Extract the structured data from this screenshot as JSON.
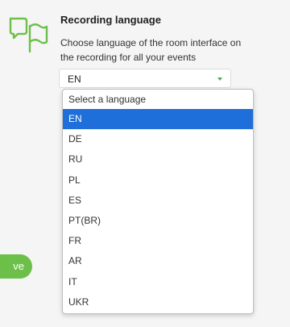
{
  "section": {
    "title": "Recording language",
    "description": "Choose language of the room interface on the recording for all your events",
    "icon": "chat-flag-icon",
    "accent_color": "#6cc04a"
  },
  "select": {
    "value": "EN",
    "placeholder": "Select a language",
    "options": [
      "EN",
      "DE",
      "RU",
      "PL",
      "ES",
      "PT(BR)",
      "FR",
      "AR",
      "IT",
      "UKR"
    ],
    "selected_index": 0,
    "highlight_color": "#1e6fd9"
  },
  "save_button": {
    "label": "ve",
    "color": "#6cc04a"
  }
}
